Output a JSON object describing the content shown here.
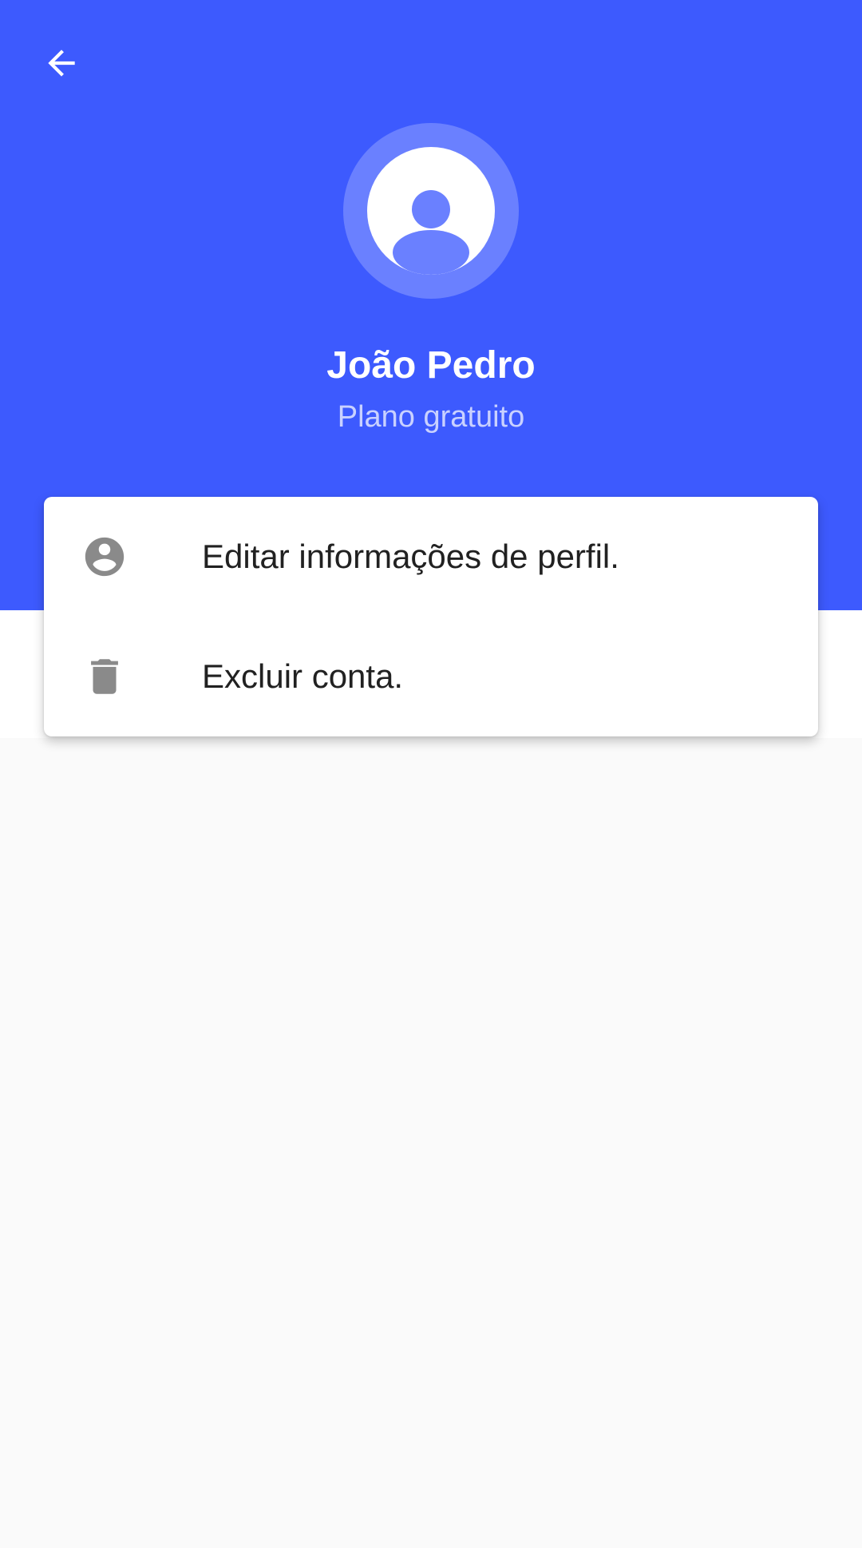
{
  "colors": {
    "header_bg": "#3d5afe",
    "avatar_ring": "#6a80ff",
    "icon_gray": "#8a8a8a",
    "text_dark": "#212121",
    "page_bg": "#fafafa"
  },
  "toolbar": {
    "back_icon": "arrow-back-icon"
  },
  "profile": {
    "avatar_icon": "account-circle-icon",
    "name": "João Pedro",
    "plan": "Plano gratuito"
  },
  "menu": {
    "items": [
      {
        "icon": "account-circle-icon",
        "label": "Editar informações de perfil."
      },
      {
        "icon": "trash-icon",
        "label": "Excluir conta."
      }
    ]
  }
}
